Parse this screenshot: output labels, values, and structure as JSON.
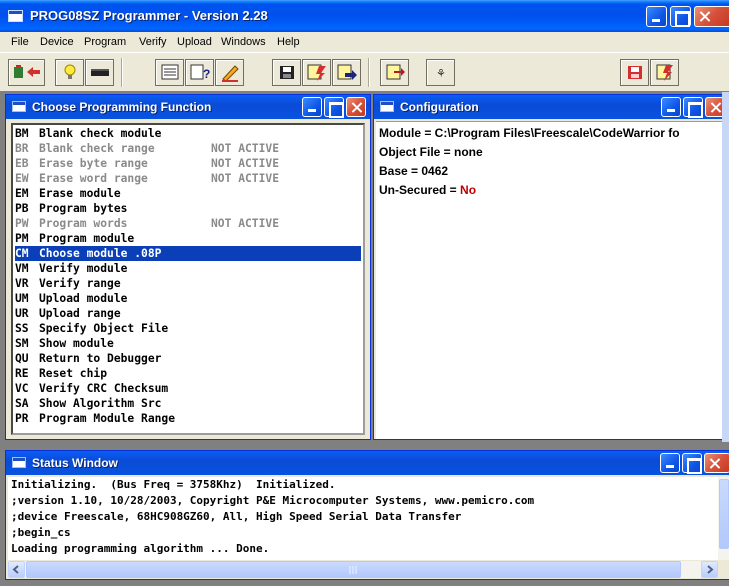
{
  "window": {
    "title": "PROG08SZ Programmer - Version 2.28"
  },
  "menu": [
    "File",
    "Device",
    "Program",
    "Verify",
    "Upload",
    "Windows",
    "Help"
  ],
  "toolbar": {
    "buttons": [
      "chip-arrow-icon",
      "lightbulb-icon",
      "chip-icon",
      "list-icon",
      "help-query-icon",
      "erase-icon",
      "save-icon",
      "program-icon",
      "upload-icon",
      "verify-icon",
      "crc-icon",
      "save-alt-icon",
      "flash-program-icon"
    ]
  },
  "function_window": {
    "title": "Choose Programming Function",
    "items": [
      {
        "code": "BM",
        "label": "Blank check module",
        "status": "",
        "active": true
      },
      {
        "code": "BR",
        "label": "Blank check range",
        "status": "NOT ACTIVE",
        "active": false
      },
      {
        "code": "EB",
        "label": "Erase byte range",
        "status": "NOT ACTIVE",
        "active": false
      },
      {
        "code": "EW",
        "label": "Erase word range",
        "status": "NOT ACTIVE",
        "active": false
      },
      {
        "code": "EM",
        "label": "Erase module",
        "status": "",
        "active": true
      },
      {
        "code": "PB",
        "label": "Program bytes",
        "status": "",
        "active": true
      },
      {
        "code": "PW",
        "label": "Program words",
        "status": "NOT ACTIVE",
        "active": false
      },
      {
        "code": "PM",
        "label": "Program module",
        "status": "",
        "active": true
      },
      {
        "code": "CM",
        "label": "Choose module .08P",
        "status": "",
        "active": true,
        "selected": true
      },
      {
        "code": "VM",
        "label": "Verify module",
        "status": "",
        "active": true
      },
      {
        "code": "VR",
        "label": "Verify range",
        "status": "",
        "active": true
      },
      {
        "code": "UM",
        "label": "Upload module",
        "status": "",
        "active": true
      },
      {
        "code": "UR",
        "label": "Upload range",
        "status": "",
        "active": true
      },
      {
        "code": "SS",
        "label": "Specify Object File",
        "status": "",
        "active": true
      },
      {
        "code": "SM",
        "label": "Show module",
        "status": "",
        "active": true
      },
      {
        "code": "QU",
        "label": "Return to Debugger",
        "status": "",
        "active": true
      },
      {
        "code": "RE",
        "label": "Reset chip",
        "status": "",
        "active": true
      },
      {
        "code": "VC",
        "label": "Verify CRC Checksum",
        "status": "",
        "active": true
      },
      {
        "code": "SA",
        "label": "Show Algorithm Src",
        "status": "",
        "active": true
      },
      {
        "code": "PR",
        "label": "Program Module Range",
        "status": "",
        "active": true
      }
    ]
  },
  "config_window": {
    "title": "Configuration",
    "lines": [
      {
        "label": "Module = C:\\Program Files\\Freescale\\CodeWarrior fo",
        "value": ""
      },
      {
        "label": "Object File = none",
        "value": ""
      },
      {
        "label": "Base = 0462",
        "value": ""
      },
      {
        "label": "Un-Secured = ",
        "value": "No"
      }
    ]
  },
  "status_window": {
    "title": "Status Window",
    "lines": [
      "Initializing.  (Bus Freq = 3758Khz)  Initialized.",
      ";version 1.10, 10/28/2003, Copyright P&E Microcomputer Systems, www.pemicro.com",
      ";device Freescale, 68HC908GZ60, All, High Speed Serial Data Transfer",
      ";begin_cs",
      "Loading programming algorithm ... Done."
    ]
  },
  "colors": {
    "titlebar": "#0053EE",
    "selection": "#0A3FB7",
    "inactive_text": "#8A8A8A",
    "no_value": "#C00000"
  }
}
